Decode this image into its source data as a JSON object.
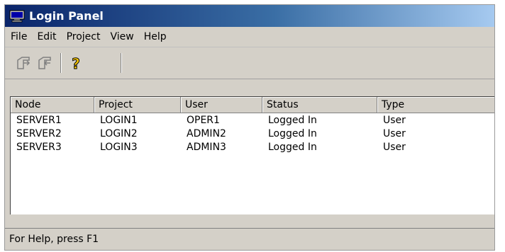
{
  "window": {
    "title": "Login Panel"
  },
  "menu": [
    "File",
    "Edit",
    "Project",
    "View",
    "Help"
  ],
  "toolbar": {
    "buttons": [
      {
        "icon": "login-icon",
        "enabled": false
      },
      {
        "icon": "logout-icon",
        "enabled": false
      },
      {
        "icon": "help-icon",
        "enabled": true
      }
    ]
  },
  "list": {
    "columns": [
      "Node",
      "Project",
      "User",
      "Status",
      "Type"
    ],
    "rows": [
      [
        "SERVER1",
        "LOGIN1",
        "OPER1",
        "Logged In",
        "User"
      ],
      [
        "SERVER2",
        "LOGIN2",
        "ADMIN2",
        "Logged In",
        "User"
      ],
      [
        "SERVER3",
        "LOGIN3",
        "ADMIN3",
        "Logged In",
        "User"
      ]
    ]
  },
  "status": {
    "text": "For Help, press F1"
  },
  "colors": {
    "title_start": "#0a246a",
    "title_end": "#a6caf0",
    "face": "#d4d0c8",
    "help_icon": "#ffcc00"
  }
}
